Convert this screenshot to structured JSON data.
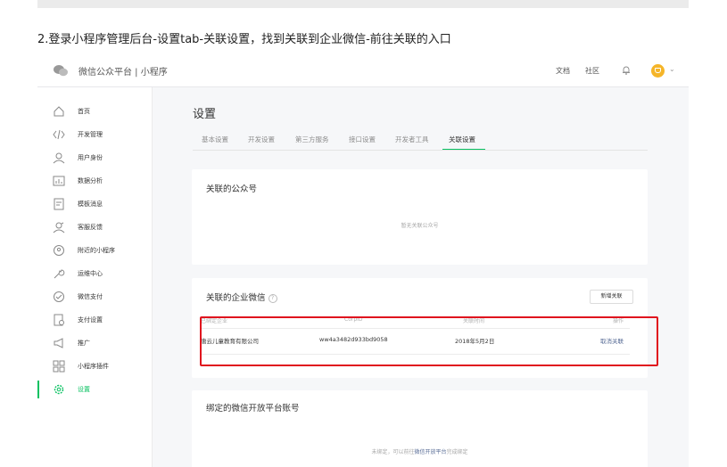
{
  "caption": "2.登录小程序管理后台-设置tab-关联设置，找到关联到企业微信-前往关联的入口",
  "header": {
    "brand": "微信公众平台 | 小程序",
    "links": [
      "文档",
      "社区"
    ]
  },
  "sidebar": {
    "items": [
      {
        "icon": "home-icon",
        "label": "首页"
      },
      {
        "icon": "code-icon",
        "label": "开发管理"
      },
      {
        "icon": "user-icon",
        "label": "用户身份"
      },
      {
        "icon": "chart-icon",
        "label": "数据分析"
      },
      {
        "icon": "template-icon",
        "label": "模板消息"
      },
      {
        "icon": "feedback-icon",
        "label": "客服反馈"
      },
      {
        "icon": "location-icon",
        "label": "附近的小程序"
      },
      {
        "icon": "wrench-icon",
        "label": "运维中心"
      },
      {
        "icon": "payment-icon",
        "label": "微信支付"
      },
      {
        "icon": "payment-settings-icon",
        "label": "支付设置"
      },
      {
        "icon": "megaphone-icon",
        "label": "推广"
      },
      {
        "icon": "plugin-icon",
        "label": "小程序插件"
      },
      {
        "icon": "gear-icon",
        "label": "设置"
      }
    ],
    "active_index": 12
  },
  "main": {
    "title": "设置",
    "tabs": [
      "基本设置",
      "开发设置",
      "第三方服务",
      "接口设置",
      "开发者工具",
      "关联设置"
    ],
    "active_tab": 5,
    "official_account": {
      "title": "关联的公众号",
      "empty": "暂无关联公众号"
    },
    "work_wechat": {
      "title": "关联的企业微信",
      "add_button": "新增关联",
      "columns": [
        "已绑定企业",
        "CorpID",
        "关联时间",
        "操作"
      ],
      "rows": [
        {
          "company": "唐云儿童教育有限公司",
          "corpid": "ww4a3482d933bd9058",
          "time": "2018年5月2日",
          "action": "取消关联"
        }
      ]
    },
    "open_platform": {
      "title": "绑定的微信开放平台账号",
      "note_prefix": "未绑定，可以前往",
      "note_link": "微信开放平台",
      "note_suffix": "完成绑定"
    }
  },
  "colors": {
    "accent": "#07c160",
    "highlight": "#e0141e",
    "link": "#576b95"
  }
}
